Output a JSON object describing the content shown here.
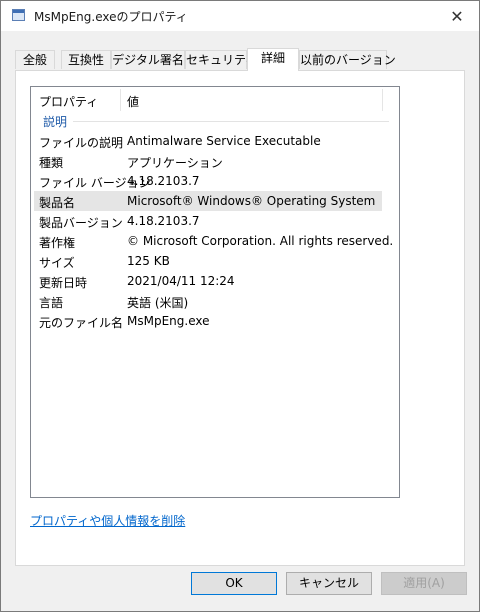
{
  "window": {
    "title": "MsMpEng.exeのプロパティ",
    "close_glyph": "✕"
  },
  "tabs": [
    {
      "label": "全般"
    },
    {
      "label": "互換性"
    },
    {
      "label": "デジタル署名"
    },
    {
      "label": "セキュリティ"
    },
    {
      "label": "詳細",
      "active": true
    },
    {
      "label": "以前のバージョン"
    }
  ],
  "details": {
    "columns": [
      "プロパティ",
      "値"
    ],
    "group": "説明",
    "rows": [
      {
        "name": "ファイルの説明",
        "value": "Antimalware Service Executable"
      },
      {
        "name": "種類",
        "value": "アプリケーション"
      },
      {
        "name": "ファイル バージョン",
        "value": "4.18.2103.7"
      },
      {
        "name": "製品名",
        "value": "Microsoft® Windows® Operating System",
        "highlighted": true
      },
      {
        "name": "製品バージョン",
        "value": "4.18.2103.7"
      },
      {
        "name": "著作権",
        "value": "© Microsoft Corporation. All rights reserved."
      },
      {
        "name": "サイズ",
        "value": "125 KB"
      },
      {
        "name": "更新日時",
        "value": "2021/04/11 12:24"
      },
      {
        "name": "言語",
        "value": "英語 (米国)"
      },
      {
        "name": "元のファイル名",
        "value": "MsMpEng.exe"
      }
    ]
  },
  "remove_link": "プロパティや個人情報を削除",
  "buttons": {
    "ok": "OK",
    "cancel": "キャンセル",
    "apply": "適用(A)"
  },
  "icons": {
    "title": "window-properties-icon",
    "close": "close-icon"
  }
}
